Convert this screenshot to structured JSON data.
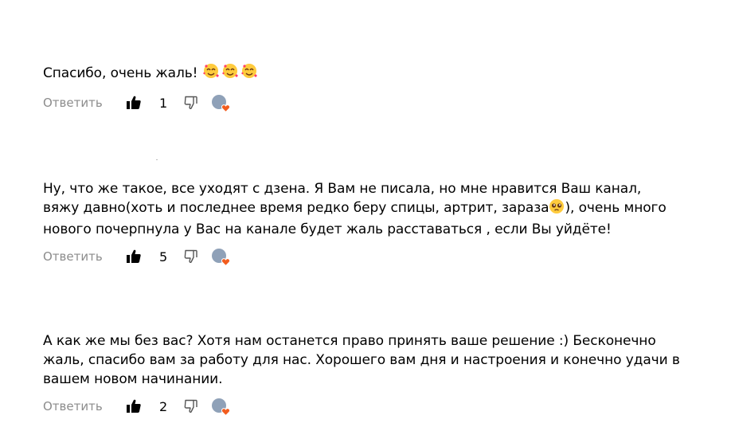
{
  "comments": [
    {
      "text": "Спасибо, очень жаль! ",
      "emoji": "smiling-face-with-hearts",
      "emoji_count": 3,
      "reply_label": "Ответить",
      "likes": "1"
    },
    {
      "text_part1": "Ну, что же такое, все уходят с дзена. Я Вам не писала, но мне нравится Ваш канал, вяжу давно(хоть и последнее время редко беру спицы, артрит, зараза",
      "emoji": "pleading-face",
      "text_part2": "), очень много нового почерпнула у Вас на канале будет жаль расставаться , если Вы уйдёте!",
      "reply_label": "Ответить",
      "likes": "5"
    },
    {
      "text": "А как же мы без вас? Хотя нам останется право принять ваше решение :) Бесконечно жаль, спасибо вам за работу для нас. Хорошего вам дня и настроения и конечно удачи в вашем новом начинании.",
      "reply_label": "Ответить",
      "likes": "2"
    }
  ],
  "colors": {
    "text": "#000000",
    "muted": "#8c8c8c",
    "heart": "#f25c1e"
  },
  "icons": {
    "like": "thumbs-up-filled-icon",
    "dislike": "thumbs-down-outline-icon",
    "author_badge": "author-avatar-heart-icon"
  }
}
